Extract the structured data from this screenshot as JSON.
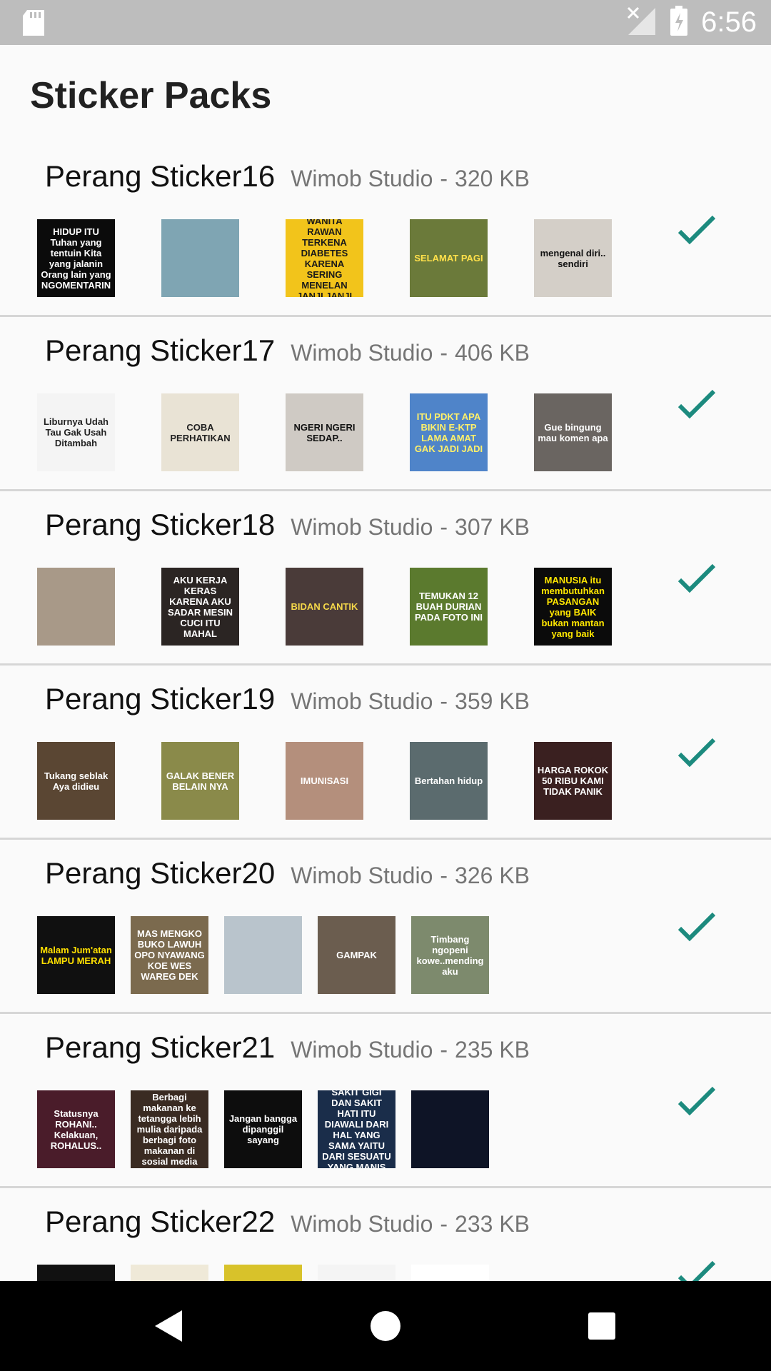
{
  "status_bar": {
    "time": "6:56",
    "icons": [
      "sd-card-icon",
      "signal-off-icon",
      "battery-charging-icon"
    ]
  },
  "app": {
    "title": "Sticker Packs"
  },
  "packs": [
    {
      "name": "Perang Sticker16",
      "publisher": "Wimob Studio",
      "separator": "-",
      "size": "320 KB",
      "added": true,
      "stickers": [
        {
          "text": "HIDUP ITU Tuhan yang tentuin Kita yang jalanin Orang lain yang NGOMENTARIN",
          "bg": "#0b0b0b",
          "fg": "#ffffff"
        },
        {
          "text": "",
          "bg": "#7fa5b3",
          "fg": "#ffffff"
        },
        {
          "text": "WARNING WANITA RAWAN TERKENA DIABETES KARENA SERING MENELAN JANJI JANJI MANIS",
          "bg": "#f2c41b",
          "fg": "#1a1a1a"
        },
        {
          "text": "SELAMAT PAGI",
          "bg": "#6b7a3a",
          "fg": "#ffe04a"
        },
        {
          "text": "mengenal diri.. sendiri",
          "bg": "#d4cfc8",
          "fg": "#111111"
        }
      ]
    },
    {
      "name": "Perang Sticker17",
      "publisher": "Wimob Studio",
      "separator": "-",
      "size": "406 KB",
      "added": true,
      "stickers": [
        {
          "text": "Liburnya Udah Tau Gak Usah Ditambah",
          "bg": "#f4f4f4",
          "fg": "#222222"
        },
        {
          "text": "COBA PERHATIKAN",
          "bg": "#e9e3d5",
          "fg": "#222222"
        },
        {
          "text": "NGERI NGERI SEDAP..",
          "bg": "#cfcac4",
          "fg": "#111111"
        },
        {
          "text": "ITU PDKT APA BIKIN E-KTP LAMA AMAT GAK JADI JADI",
          "bg": "#4f84c9",
          "fg": "#fff06a"
        },
        {
          "text": "Gue bingung mau komen apa",
          "bg": "#6a6561",
          "fg": "#ffffff"
        }
      ]
    },
    {
      "name": "Perang Sticker18",
      "publisher": "Wimob Studio",
      "separator": "-",
      "size": "307 KB",
      "added": true,
      "stickers": [
        {
          "text": "",
          "bg": "#a89988",
          "fg": "#ffffff"
        },
        {
          "text": "AKU KERJA KERAS KARENA AKU SADAR MESIN CUCI ITU MAHAL",
          "bg": "#2b2523",
          "fg": "#ffffff"
        },
        {
          "text": "BIDAN CANTIK",
          "bg": "#4a3b39",
          "fg": "#f5d84a"
        },
        {
          "text": "TEMUKAN 12 BUAH DURIAN PADA FOTO INI",
          "bg": "#5b7a2e",
          "fg": "#ffffff"
        },
        {
          "text": "MANUSIA itu membutuhkan PASANGAN yang BAIK bukan mantan yang baik",
          "bg": "#0b0b0b",
          "fg": "#ffe600"
        }
      ]
    },
    {
      "name": "Perang Sticker19",
      "publisher": "Wimob Studio",
      "separator": "-",
      "size": "359 KB",
      "added": true,
      "stickers": [
        {
          "text": "Tukang seblak Aya didieu",
          "bg": "#5a4633",
          "fg": "#ffffff"
        },
        {
          "text": "GALAK BENER BELAIN NYA",
          "bg": "#8a8a4a",
          "fg": "#ffffff"
        },
        {
          "text": "IMUNISASI",
          "bg": "#b48f7c",
          "fg": "#ffffff"
        },
        {
          "text": "Bertahan hidup",
          "bg": "#5b6b6e",
          "fg": "#ffffff"
        },
        {
          "text": "HARGA ROKOK 50 RIBU KAMI TIDAK PANIK",
          "bg": "#3a2020",
          "fg": "#ffffff"
        }
      ]
    },
    {
      "name": "Perang Sticker20",
      "publisher": "Wimob Studio",
      "separator": "-",
      "size": "326 KB",
      "added": true,
      "stickers": [
        {
          "text": "Malam Jum'atan LAMPU MERAH",
          "bg": "#101010",
          "fg": "#ffe000"
        },
        {
          "text": "MAS MENGKO BUKO LAWUH OPO NYAWANG KOE WES WAREG DEK",
          "bg": "#7b6a4e",
          "fg": "#ffffff"
        },
        {
          "text": "",
          "bg": "#b9c4cc",
          "fg": "#ffffff"
        },
        {
          "text": "GAMPAK",
          "bg": "#6b5d4f",
          "fg": "#ffffff"
        },
        {
          "text": "Timbang ngopeni kowe..mending aku",
          "bg": "#7d8a6d",
          "fg": "#ffffff"
        }
      ]
    },
    {
      "name": "Perang Sticker21",
      "publisher": "Wimob Studio",
      "separator": "-",
      "size": "235 KB",
      "added": true,
      "stickers": [
        {
          "text": "Statusnya ROHANI.. Kelakuan, ROHALUS..",
          "bg": "#4a1c2a",
          "fg": "#ffffff"
        },
        {
          "text": "Berbagi makanan ke tetangga lebih mulia daripada berbagi foto makanan di sosial media",
          "bg": "#3a2b22",
          "fg": "#ffffff"
        },
        {
          "text": "Jangan bangga dipanggil sayang",
          "bg": "#0d0d0d",
          "fg": "#ffffff"
        },
        {
          "text": "SAKIT GIGI DAN SAKIT HATI ITU DIAWALI DARI HAL YANG SAMA YAITU DARI SESUATU YANG MANIS",
          "bg": "#1a2d4a",
          "fg": "#ffffff"
        },
        {
          "text": "",
          "bg": "#0e1426",
          "fg": "#ffffff"
        }
      ]
    },
    {
      "name": "Perang Sticker22",
      "publisher": "Wimob Studio",
      "separator": "-",
      "size": "233 KB",
      "added": true,
      "stickers": [
        {
          "text": "",
          "bg": "#111111",
          "fg": "#ffffff"
        },
        {
          "text": "",
          "bg": "#efe9d8",
          "fg": "#222222"
        },
        {
          "text": "",
          "bg": "#d8c22a",
          "fg": "#111111"
        },
        {
          "text": "",
          "bg": "#f4f4f4",
          "fg": "#222222"
        },
        {
          "text": "",
          "bg": "#ffffff",
          "fg": "#b11a1a"
        }
      ]
    }
  ],
  "colors": {
    "check": "#1c8a7e",
    "status_bar": "#bdbdbd",
    "nav_bar": "#000000"
  },
  "nav": {
    "back": "back-icon",
    "home": "home-icon",
    "recents": "recents-icon"
  }
}
